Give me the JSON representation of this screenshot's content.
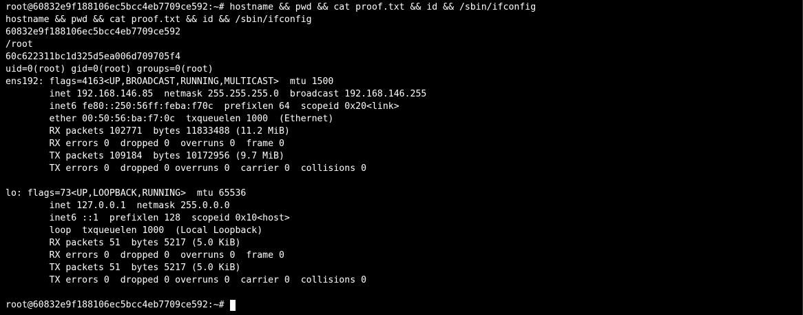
{
  "terminal": {
    "lines": [
      "root@60832e9f188106ec5bcc4eb7709ce592:~# hostname && pwd && cat proof.txt && id && /sbin/ifconfig",
      "hostname && pwd && cat proof.txt && id && /sbin/ifconfig",
      "60832e9f188106ec5bcc4eb7709ce592",
      "/root",
      "60c622311bc1d325d5ea006d709705f4",
      "uid=0(root) gid=0(root) groups=0(root)",
      "ens192: flags=4163<UP,BROADCAST,RUNNING,MULTICAST>  mtu 1500",
      "        inet 192.168.146.85  netmask 255.255.255.0  broadcast 192.168.146.255",
      "        inet6 fe80::250:56ff:feba:f70c  prefixlen 64  scopeid 0x20<link>",
      "        ether 00:50:56:ba:f7:0c  txqueuelen 1000  (Ethernet)",
      "        RX packets 102771  bytes 11833488 (11.2 MiB)",
      "        RX errors 0  dropped 0  overruns 0  frame 0",
      "        TX packets 109184  bytes 10172956 (9.7 MiB)",
      "        TX errors 0  dropped 0 overruns 0  carrier 0  collisions 0",
      "",
      "lo: flags=73<UP,LOOPBACK,RUNNING>  mtu 65536",
      "        inet 127.0.0.1  netmask 255.0.0.0",
      "        inet6 ::1  prefixlen 128  scopeid 0x10<host>",
      "        loop  txqueuelen 1000  (Local Loopback)",
      "        RX packets 51  bytes 5217 (5.0 KiB)",
      "        RX errors 0  dropped 0  overruns 0  frame 0",
      "        TX packets 51  bytes 5217 (5.0 KiB)",
      "        TX errors 0  dropped 0 overruns 0  carrier 0  collisions 0",
      ""
    ],
    "prompt": "root@60832e9f188106ec5bcc4eb7709ce592:~# "
  },
  "colors": {
    "background": "#000000",
    "foreground": "#ffffff"
  }
}
